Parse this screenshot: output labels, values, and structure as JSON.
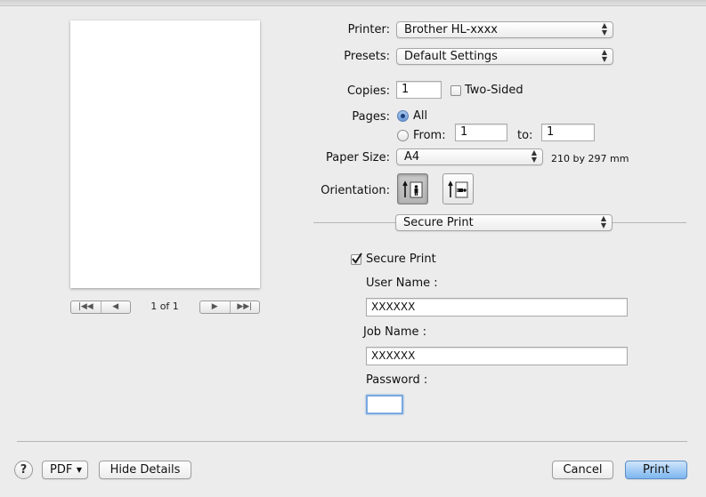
{
  "preview": {
    "page_counter": "1 of 1",
    "nav_first": "|◀◀",
    "nav_prev": "◀",
    "nav_next": "▶",
    "nav_last": "▶▶|"
  },
  "printer": {
    "label": "Printer:",
    "value": "Brother HL-xxxx"
  },
  "presets": {
    "label": "Presets:",
    "value": "Default Settings"
  },
  "copies": {
    "label": "Copies:",
    "value": "1",
    "two_sided_label": "Two-Sided",
    "two_sided_checked": false
  },
  "pages": {
    "label": "Pages:",
    "all_label": "All",
    "from_label": "From:",
    "from_value": "1",
    "to_label": "to:",
    "to_value": "1",
    "selected": "All"
  },
  "paper_size": {
    "label": "Paper Size:",
    "value": "A4",
    "dimensions": "210 by 297 mm"
  },
  "orientation": {
    "label": "Orientation:",
    "selected": "portrait"
  },
  "section_popup": {
    "value": "Secure Print"
  },
  "secure_print": {
    "checkbox_label": "Secure Print",
    "checked": true,
    "user_name_label": "User Name :",
    "user_name_value": "XXXXXX",
    "job_name_label": "Job Name :",
    "job_name_value": "XXXXXX",
    "password_label": "Password :",
    "password_value": ""
  },
  "footer": {
    "help_label": "?",
    "pdf_label": "PDF",
    "hide_details_label": "Hide Details",
    "cancel_label": "Cancel",
    "print_label": "Print"
  },
  "icons": {
    "up_down_arrows": "up-down-arrows-icon",
    "dropdown": "chevron-down-icon",
    "portrait": "portrait-orientation-icon",
    "landscape": "landscape-orientation-icon",
    "checkmark": "checkmark-icon"
  },
  "colors": {
    "accent": "#7db6ef",
    "background": "#ececec",
    "focus_ring": "#7aa9e0"
  }
}
